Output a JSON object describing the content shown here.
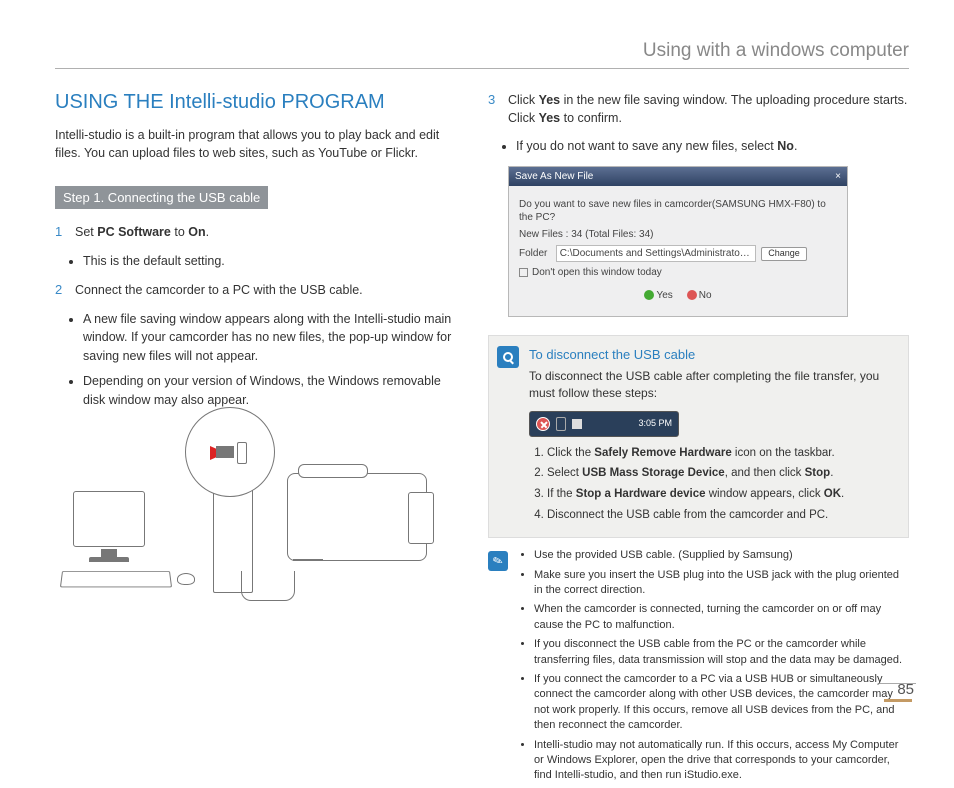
{
  "header": {
    "title": "Using with a windows computer"
  },
  "left": {
    "heading": "USING THE Intelli-studio PROGRAM",
    "intro": "Intelli-studio is a built-in program that allows you to play back and edit files. You can upload files to web sites, such as YouTube or Flickr.",
    "stepbar": "Step 1. Connecting the USB cable",
    "step1_pre": "Set ",
    "step1_b1": "PC Software",
    "step1_mid": " to ",
    "step1_b2": "On",
    "step1_post": ".",
    "step1_sub": "This is the default setting.",
    "step2": "Connect the camcorder to a PC with the USB cable.",
    "step2_sub1": "A new file saving window appears along with the Intelli-studio main window. If your camcorder has no new files, the pop-up window for saving new files will not appear.",
    "step2_sub2": "Depending on your version of Windows, the Windows removable disk window may also appear."
  },
  "right": {
    "step3_pre": "Click ",
    "step3_b1": "Yes",
    "step3_mid": " in the new file saving window. The uploading procedure starts. Click ",
    "step3_b2": "Yes",
    "step3_post": " to confirm.",
    "step3_sub_pre": "If you do not want to save any new files, select ",
    "step3_sub_b": "No",
    "step3_sub_post": ".",
    "dialog": {
      "title": "Save As New File",
      "q": "Do you want to save new files in camcorder(SAMSUNG HMX-F80) to the PC?",
      "newfiles_label": "New Files : 34 (Total Files: 34)",
      "folder_label": "Folder",
      "folder_path": "C:\\Documents and Settings\\Administrator\\My Documents\\Intelli-s",
      "change": "Change",
      "dont_open": "Don't open this window today",
      "yes": "Yes",
      "no": "No"
    },
    "disconnect": {
      "title": "To disconnect the USB cable",
      "intro": "To disconnect the USB cable after completing the file transfer, you must follow these steps:",
      "taskbar_time": "3:05 PM",
      "s1_pre": "Click the ",
      "s1_b": "Safely Remove Hardware",
      "s1_post": " icon on the taskbar.",
      "s2_pre": "Select ",
      "s2_b": "USB Mass Storage Device",
      "s2_mid": ", and then click ",
      "s2_b2": "Stop",
      "s2_post": ".",
      "s3_pre": "If the ",
      "s3_b": "Stop a Hardware device",
      "s3_mid": " window appears, click ",
      "s3_b2": "OK",
      "s3_post": ".",
      "s4": "Disconnect the USB cable from the camcorder and PC."
    },
    "notes": {
      "n1": "Use the provided USB cable. (Supplied by Samsung)",
      "n2": "Make sure you insert the USB plug into the USB jack with the plug oriented in the correct direction.",
      "n3": "When the camcorder is connected, turning the camcorder on or off may cause the PC to malfunction.",
      "n4": "If you disconnect the USB cable from the PC or the camcorder while transferring files, data transmission will stop and the data may be damaged.",
      "n5": "If you connect the camcorder to a PC via a USB HUB or simultaneously connect the camcorder along with other USB devices, the camcorder may not work properly. If this occurs, remove all USB devices from the PC, and then reconnect the camcorder.",
      "n6": "Intelli-studio may not automatically run. If this occurs, access My Computer or Windows Explorer, open the drive that corresponds to your camcorder, find Intelli-studio, and then run iStudio.exe."
    }
  },
  "page_number": "85"
}
